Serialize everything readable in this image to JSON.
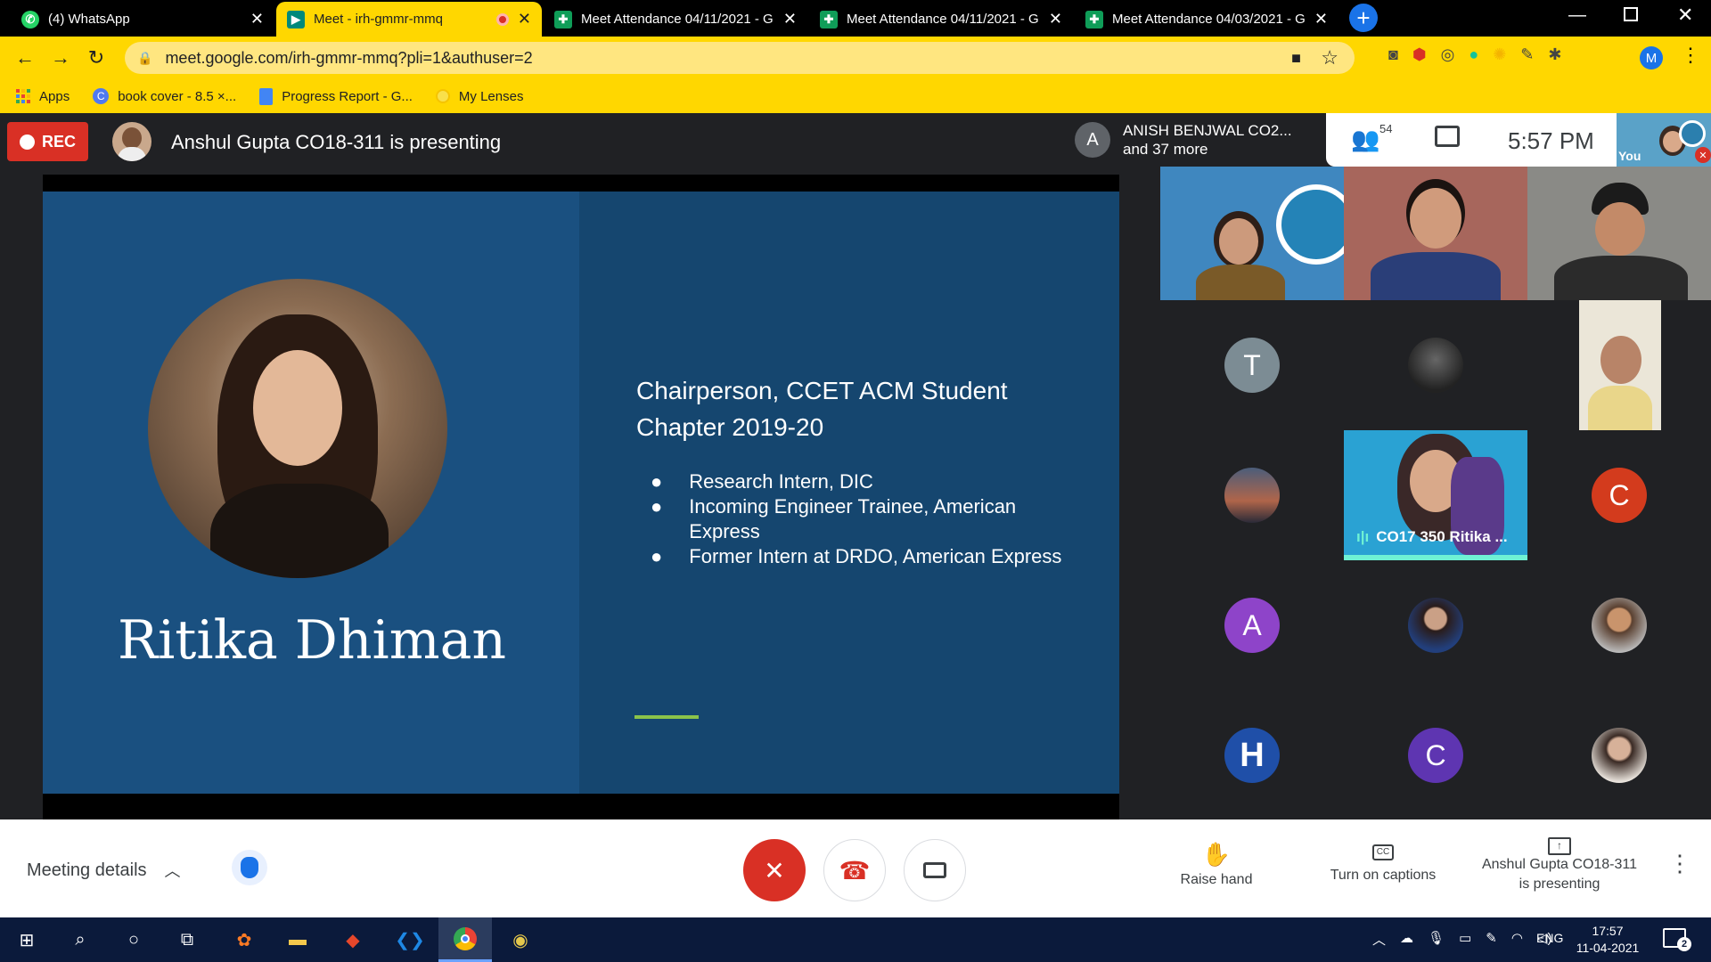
{
  "tabs": [
    {
      "title": "(4) WhatsApp",
      "icon_color": "#25d366",
      "icon": "whatsapp-icon"
    },
    {
      "title": "Meet - irh-gmmr-mmq",
      "icon_color": "#00897b",
      "icon": "meet-icon"
    },
    {
      "title": "Meet Attendance 04/11/2021 - G",
      "icon_color": "#0f9d58",
      "icon": "sheets-icon"
    },
    {
      "title": "Meet Attendance 04/11/2021 - G",
      "icon_color": "#0f9d58",
      "icon": "sheets-icon"
    },
    {
      "title": "Meet Attendance 04/03/2021 - G",
      "icon_color": "#0f9d58",
      "icon": "sheets-icon"
    }
  ],
  "url": "meet.google.com/irh-gmmr-mmq?pli=1&authuser=2",
  "profile_initial": "M",
  "bookmarks": [
    {
      "label": "Apps"
    },
    {
      "label": "book cover - 8.5 ×..."
    },
    {
      "label": "Progress Report - G..."
    },
    {
      "label": "My Lenses"
    }
  ],
  "meet": {
    "rec_label": "REC",
    "presenting_label": "Anshul Gupta CO18-311 is presenting",
    "speaker_initial": "A",
    "speaker_name": "ANISH BENJWAL CO2...",
    "speaker_more": "and 37 more",
    "participant_count": "54",
    "time": "5:57  PM",
    "self_label": "You"
  },
  "slide": {
    "name": "Ritika Dhiman",
    "heading_line1": "Chairperson, CCET ACM Student",
    "heading_line2": "Chapter 2019-20",
    "bullets": [
      "Research Intern, DIC",
      "Incoming Engineer Trainee, American",
      "Express",
      "Former Intern at DRDO, American Express"
    ]
  },
  "participants": {
    "t_initial": "T",
    "c_initial": "C",
    "a_initial": "A",
    "c2_initial": "C",
    "h_initial": "H",
    "active_speaker_label": "CO17 350 Ritika ..."
  },
  "bottom": {
    "meeting_details": "Meeting details",
    "raise_hand": "Raise hand",
    "captions": "Turn on captions",
    "presenting_line1": "Anshul Gupta CO18-311",
    "presenting_line2": "is presenting"
  },
  "taskbar": {
    "lang": "ENG",
    "time": "17:57",
    "date": "11-04-2021",
    "notif_count": "2"
  },
  "colors": {
    "accent": "#ffd700",
    "rec": "#d93025",
    "meet_bg": "#202124",
    "slide_bg": "#1a5080",
    "teal": "#6ff2d4"
  }
}
